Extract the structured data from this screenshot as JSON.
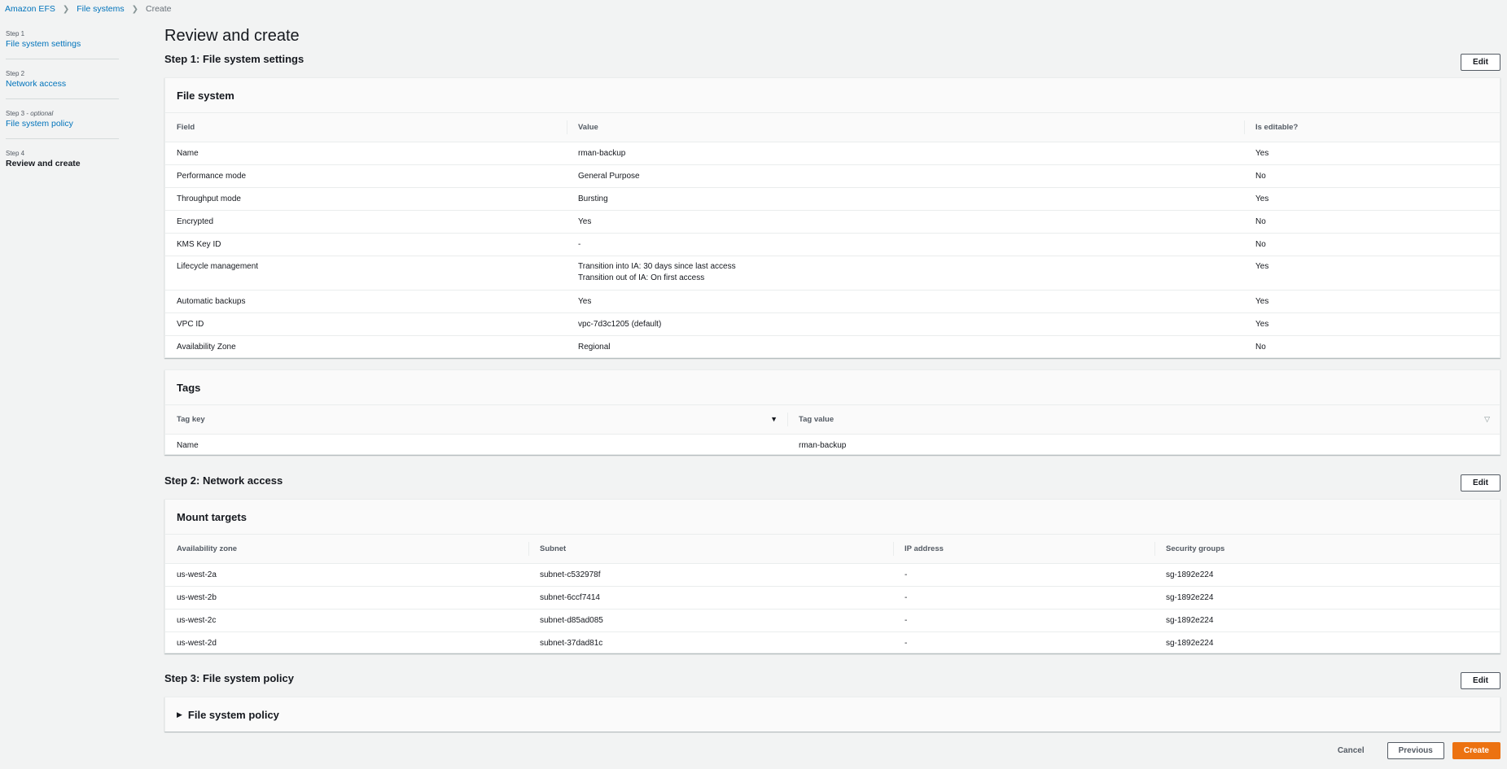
{
  "breadcrumb": {
    "items": [
      "Amazon EFS",
      "File systems"
    ],
    "current": "Create"
  },
  "steps": [
    {
      "num": "Step 1",
      "title": "File system settings"
    },
    {
      "num": "Step 2",
      "title": "Network access"
    },
    {
      "num": "Step 3",
      "optional": "optional",
      "title": "File system policy"
    },
    {
      "num": "Step 4",
      "title": "Review and create"
    }
  ],
  "page_title": "Review and create",
  "edit_label": "Edit",
  "step1": {
    "title": "Step 1: File system settings",
    "file_system": {
      "header": "File system",
      "columns": [
        "Field",
        "Value",
        "Is editable?"
      ],
      "rows": [
        {
          "field": "Name",
          "value": "rman-backup",
          "editable": "Yes"
        },
        {
          "field": "Performance mode",
          "value": "General Purpose",
          "editable": "No"
        },
        {
          "field": "Throughput mode",
          "value": "Bursting",
          "editable": "Yes"
        },
        {
          "field": "Encrypted",
          "value": "Yes",
          "editable": "No"
        },
        {
          "field": "KMS Key ID",
          "value": "-",
          "editable": "No"
        },
        {
          "field": "Lifecycle management",
          "value": "Transition into IA: 30 days since last access",
          "value2": "Transition out of IA: On first access",
          "editable": "Yes"
        },
        {
          "field": "Automatic backups",
          "value": "Yes",
          "editable": "Yes"
        },
        {
          "field": "VPC ID",
          "value": "vpc-7d3c1205 (default)",
          "editable": "Yes"
        },
        {
          "field": "Availability Zone",
          "value": "Regional",
          "editable": "No"
        }
      ]
    },
    "tags": {
      "header": "Tags",
      "columns": [
        "Tag key",
        "Tag value"
      ],
      "rows": [
        {
          "key": "Name",
          "value": "rman-backup"
        }
      ]
    }
  },
  "step2": {
    "title": "Step 2: Network access",
    "mount_targets": {
      "header": "Mount targets",
      "columns": [
        "Availability zone",
        "Subnet",
        "IP address",
        "Security groups"
      ],
      "rows": [
        {
          "az": "us-west-2a",
          "subnet": "subnet-c532978f",
          "ip": "-",
          "sg": "sg-1892e224"
        },
        {
          "az": "us-west-2b",
          "subnet": "subnet-6ccf7414",
          "ip": "-",
          "sg": "sg-1892e224"
        },
        {
          "az": "us-west-2c",
          "subnet": "subnet-d85ad085",
          "ip": "-",
          "sg": "sg-1892e224"
        },
        {
          "az": "us-west-2d",
          "subnet": "subnet-37dad81c",
          "ip": "-",
          "sg": "sg-1892e224"
        }
      ]
    }
  },
  "step3": {
    "title": "Step 3: File system policy",
    "policy_header": "File system policy"
  },
  "footer": {
    "cancel": "Cancel",
    "previous": "Previous",
    "create": "Create"
  },
  "colors": {
    "link": "#0073bb",
    "primary": "#ec7211",
    "background": "#f2f3f3"
  }
}
